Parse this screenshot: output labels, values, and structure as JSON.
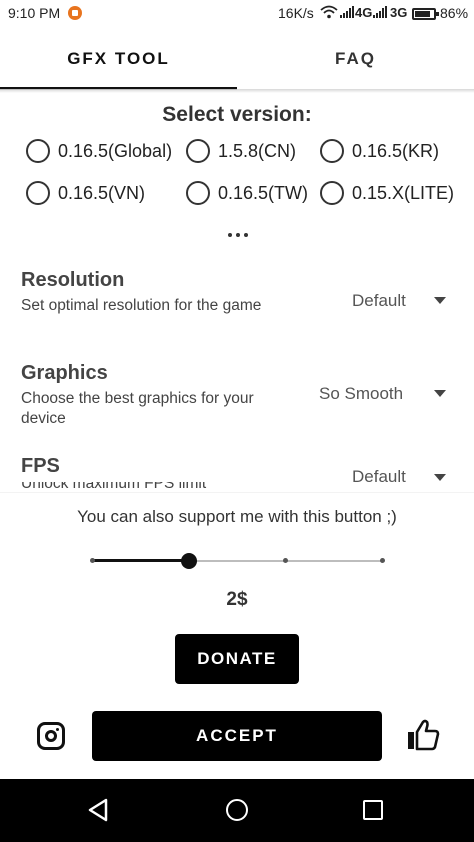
{
  "status_bar": {
    "time": "9:10 PM",
    "net_speed": "16K/s",
    "network_1": "4G",
    "network_2": "3G",
    "battery": "86%"
  },
  "tabs": [
    {
      "label": "GFX TOOL",
      "selected": true
    },
    {
      "label": "FAQ",
      "selected": false
    }
  ],
  "version": {
    "title": "Select version:",
    "options": [
      {
        "label": "0.16.5(Global)",
        "selected": false
      },
      {
        "label": "1.5.8(CN)",
        "selected": false
      },
      {
        "label": "0.16.5(KR)",
        "selected": false
      },
      {
        "label": "0.16.5(VN)",
        "selected": false
      },
      {
        "label": "0.16.5(TW)",
        "selected": false
      },
      {
        "label": "0.15.X(LITE)",
        "selected": false
      }
    ]
  },
  "settings": [
    {
      "title": "Resolution",
      "description": "Set optimal resolution for the game",
      "value": "Default"
    },
    {
      "title": "Graphics",
      "description": "Choose the best graphics for your device",
      "value": "So Smooth"
    },
    {
      "title": "FPS",
      "description": "Unlock maximum FPS limit",
      "value": "Default"
    }
  ],
  "support": {
    "text": "You can also support me with this button ;)",
    "slider_steps": 4,
    "slider_selected_index": 1,
    "amount": "2$",
    "donate_label": "DONATE"
  },
  "actions": {
    "accept_label": "ACCEPT",
    "left_icon": "instagram-icon",
    "right_icon": "thumbs-up-icon"
  },
  "colors": {
    "primary": "#000000",
    "background": "#ffffff",
    "status_app_icon": "#e8741e"
  }
}
